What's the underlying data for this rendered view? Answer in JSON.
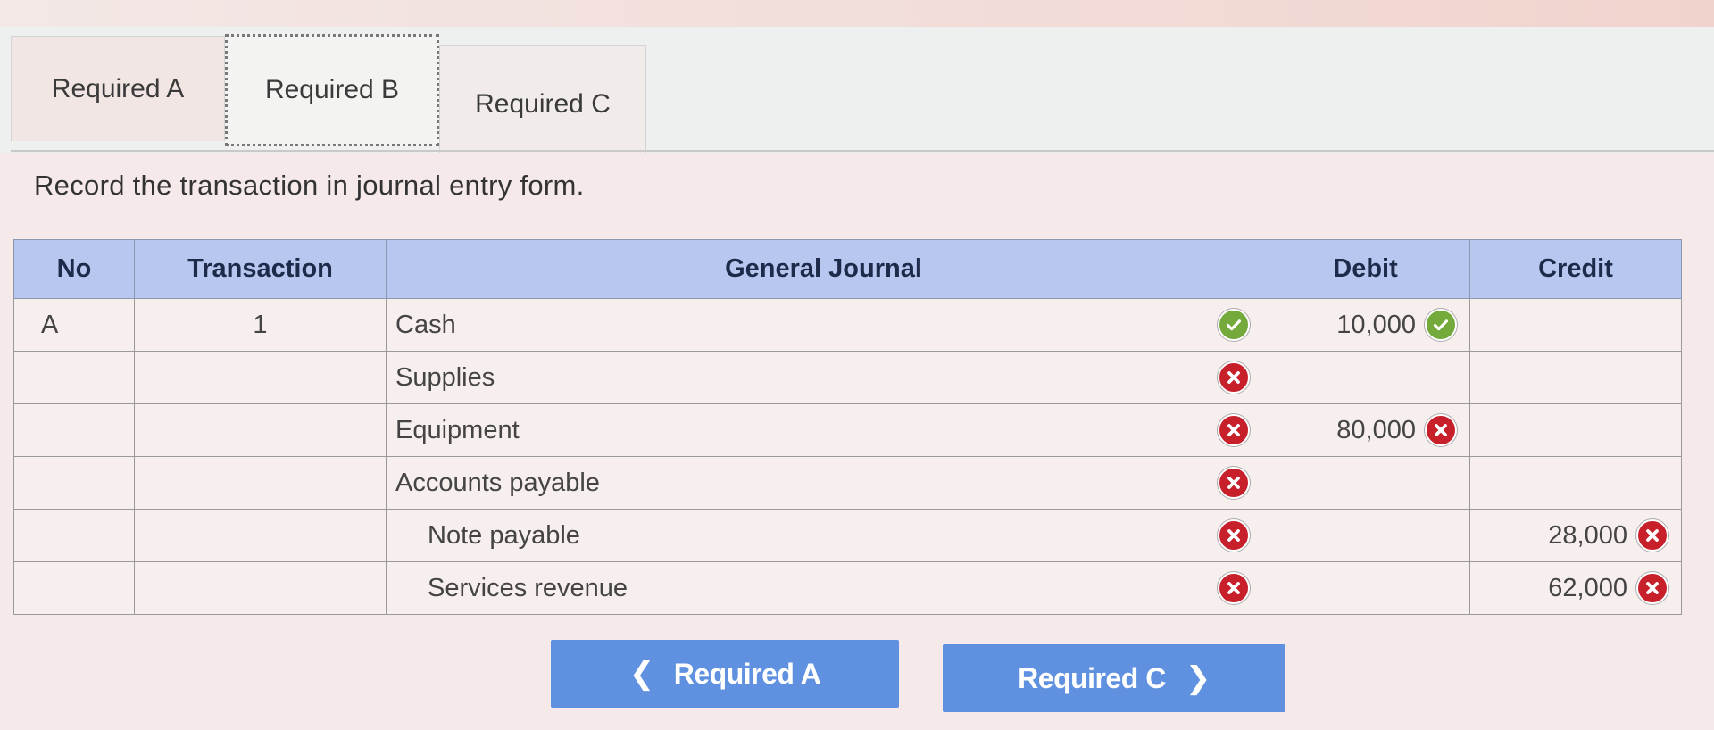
{
  "tabs": [
    {
      "label": "Required A"
    },
    {
      "label": "Required B"
    },
    {
      "label": "Required C"
    }
  ],
  "instruction": "Record the transaction in journal entry form.",
  "table": {
    "headers": {
      "no": "No",
      "transaction": "Transaction",
      "general_journal": "General Journal",
      "debit": "Debit",
      "credit": "Credit"
    },
    "rows": [
      {
        "no": "A",
        "transaction": "1",
        "account": "Cash",
        "account_status": "correct",
        "debit": "10,000",
        "debit_status": "correct",
        "credit": "",
        "credit_status": ""
      },
      {
        "no": "",
        "transaction": "",
        "account": "Supplies",
        "account_status": "incorrect",
        "debit": "",
        "debit_status": "",
        "credit": "",
        "credit_status": ""
      },
      {
        "no": "",
        "transaction": "",
        "account": "Equipment",
        "account_status": "incorrect",
        "debit": "80,000",
        "debit_status": "incorrect",
        "credit": "",
        "credit_status": ""
      },
      {
        "no": "",
        "transaction": "",
        "account": "Accounts payable",
        "account_status": "incorrect",
        "debit": "",
        "debit_status": "",
        "credit": "",
        "credit_status": ""
      },
      {
        "no": "",
        "transaction": "",
        "account": "Note payable",
        "account_status": "incorrect",
        "debit": "",
        "debit_status": "",
        "credit": "28,000",
        "credit_status": "incorrect"
      },
      {
        "no": "",
        "transaction": "",
        "account": "Services revenue",
        "account_status": "incorrect",
        "debit": "",
        "debit_status": "",
        "credit": "62,000",
        "credit_status": "incorrect"
      }
    ]
  },
  "nav": {
    "prev_label": "Required A",
    "next_label": "Required C"
  },
  "icons": {
    "correct": "check-circle-icon",
    "incorrect": "x-circle-icon",
    "prev": "chevron-left-icon",
    "next": "chevron-right-icon"
  },
  "colors": {
    "correct": "#74a93b",
    "incorrect": "#c8202b",
    "header_bg": "#b8c7ef",
    "button_bg": "#5f91e0"
  }
}
